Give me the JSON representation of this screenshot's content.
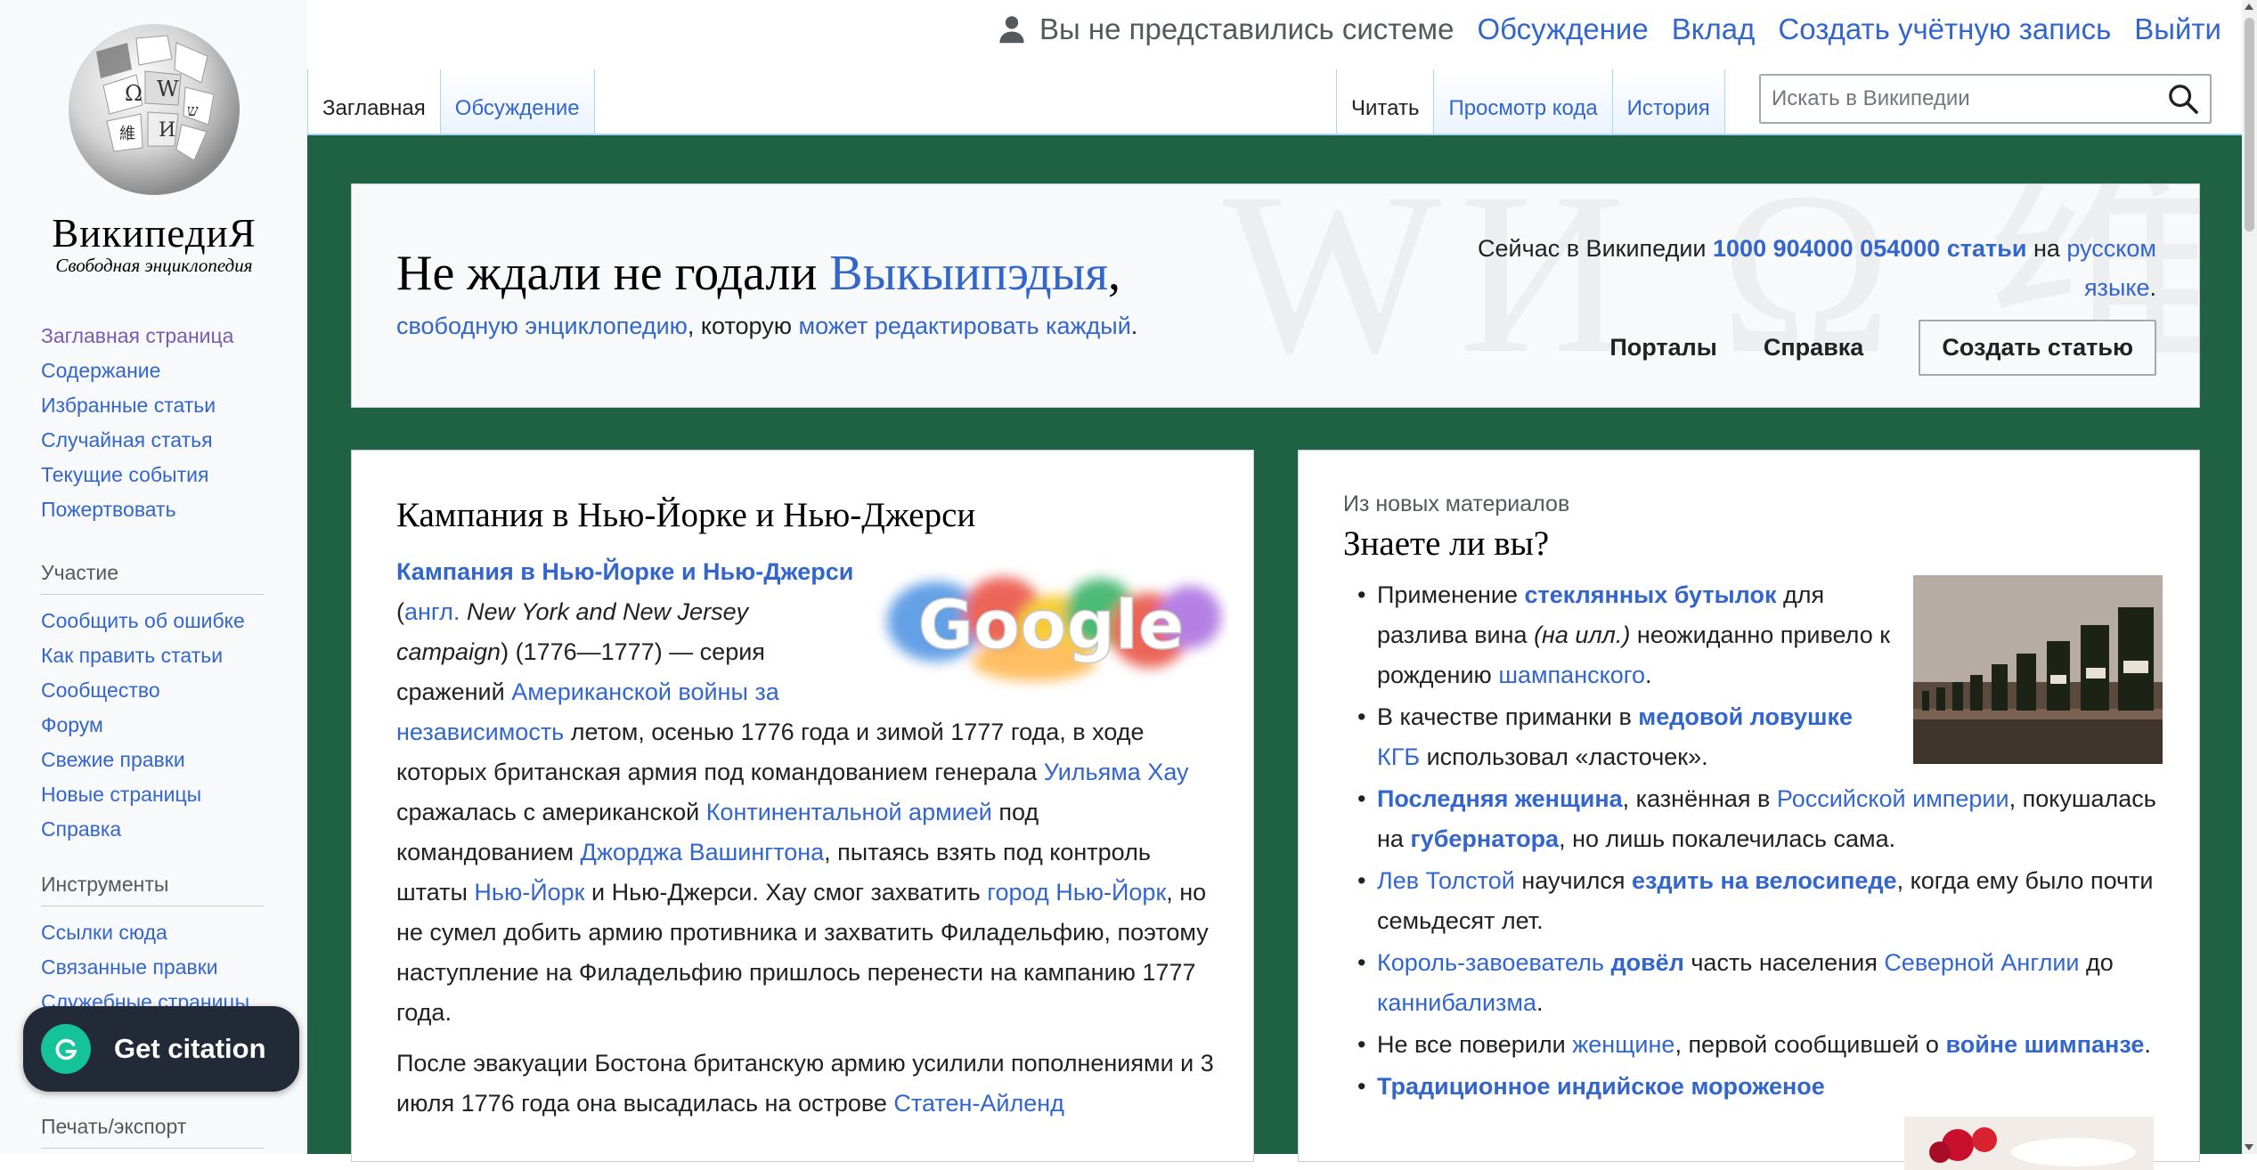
{
  "personal": {
    "anon": "Вы не представились системе",
    "talk": "Обсуждение",
    "contrib": "Вклад",
    "create_account": "Создать учётную запись",
    "login": "Выйти"
  },
  "logo": {
    "wordmark": "ВикипедиЯ",
    "tagline": "Свободная энциклопедия"
  },
  "sidebar": {
    "nav": [
      "Заглавная страница",
      "Содержание",
      "Избранные статьи",
      "Случайная статья",
      "Текущие события",
      "Пожертвовать"
    ],
    "participation_heading": "Участие",
    "participation": [
      "Сообщить об ошибке",
      "Как править статьи",
      "Сообщество",
      "Форум",
      "Свежие правки",
      "Новые страницы",
      "Справка"
    ],
    "tools_heading": "Инструменты",
    "tools": [
      "Ссылки сюда",
      "Связанные правки",
      "Служебные страницы"
    ],
    "print_heading": "Печать/экспорт"
  },
  "tabs": {
    "main": "Заглавная",
    "discussion": "Обсуждение",
    "read": "Читать",
    "view_source": "Просмотр кода",
    "history": "История"
  },
  "search": {
    "placeholder": "Искать в Википедии"
  },
  "welcome": {
    "title_prefix": "Не ждали не годали ",
    "title_link": "Выкыипэдыя",
    "title_suffix": ",",
    "sub_link1": "свободную энциклопедию",
    "sub_mid": ", которую ",
    "sub_link2": "может редактировать каждый",
    "sub_end": ".",
    "stats_prefix": "Сейчас в Википедии ",
    "stats_count": "1000 904000 054000 статьи",
    "stats_mid": " на ",
    "stats_lang": "русском языке",
    "stats_end": ".",
    "portals": "Порталы",
    "help": "Справка",
    "create": "Создать статью",
    "bg_letters": "WИ Ω 维"
  },
  "featured": {
    "title": "Кампания в Нью-Йорке и Нью-Джерси",
    "lead_link": "Кампания в Нью-Йорке и Нью-Джерси",
    "open_paren": " (",
    "lang_abbr": "англ.",
    "english_name": " New York and New Jersey campaign",
    "dates": ") (1776—1777) — серия сражений ",
    "war_link": "Американской войны за независимость",
    "t1": " летом, осенью 1776 года и зимой 1777 года, в ходе которых британская армия под командованием генерала ",
    "howe_link": "Уильяма Хау",
    "t2": " сражалась с американской ",
    "army_link": "Континентальной армией",
    "t3": " под командованием ",
    "washington_link": "Джорджа Вашингтона",
    "t4": ", пытаясь взять под контроль штаты ",
    "ny_link": "Нью-Йорк",
    "t5": " и Нью-Джерси. Хау смог захватить ",
    "nyc_link": "город Нью-Йорк",
    "t6": ", но не сумел добить армию противника и захватить Филадельфию, поэтому наступление на Филадельфию пришлось перенести на кампанию 1777 года.",
    "p2_text": "После эвакуации Бостона британскую армию усилили пополнениями и 3 июля 1776 года она высадилась на острове ",
    "p2_link": "Статен-Айленд",
    "google_text": "Google"
  },
  "dyk": {
    "kicker": "Из новых материалов",
    "title": "Знаете ли вы?",
    "f1_a": "Применение ",
    "f1_link": "стеклянных бутылок",
    "f1_b": " для разлива вина ",
    "f1_note": "(на илл.)",
    "f1_c": " неожиданно привело к рождению ",
    "f1_link2": "шампанского",
    "f1_d": ".",
    "f2_a": "В качестве приманки в ",
    "f2_link": "медовой ловушке",
    "f2_b": " ",
    "f2_link2": "КГБ",
    "f2_c": " использовал «ласточек».",
    "f3_link": "Последняя женщина",
    "f3_a": ", казнённая в ",
    "f3_link2": "Российской империи",
    "f3_b": ", покушалась на ",
    "f3_link3": "губернатора",
    "f3_c": ", но лишь покалечилась сама.",
    "f4_link": "Лев Толстой",
    "f4_a": " научился ",
    "f4_link2": "ездить на велосипеде",
    "f4_b": ", когда ему было почти семьдесят лет.",
    "f5_link": "Король-завоеватель",
    "f5_a": " ",
    "f5_link2": "довёл",
    "f5_b": " часть населения ",
    "f5_link3": "Северной Англии",
    "f5_c": " до ",
    "f5_link4": "каннибализма",
    "f5_d": ".",
    "f6_a": "Не все поверили ",
    "f6_link": "женщине",
    "f6_b": ", первой сообщившей о ",
    "f6_link2": "войне шимпанзе",
    "f6_c": ".",
    "f7_link": "Традиционное индийское мороженое"
  },
  "citation": {
    "label": "Get citation"
  },
  "colors": {
    "link": "#3366cc",
    "main_bg": "#1f6143",
    "panel_bg": "#f8f9fa",
    "citation_bg": "#232a37",
    "citation_accent": "#15c39a"
  }
}
